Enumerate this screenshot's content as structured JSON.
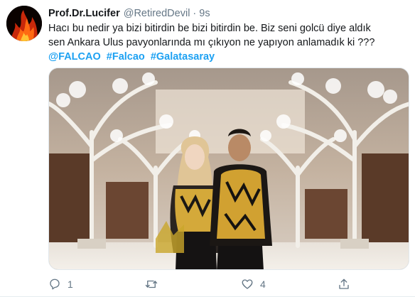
{
  "tweet": {
    "display_name": "Prof.Dr.Lucifer",
    "handle": "@RetiredDevil",
    "separator": "·",
    "time": "9s",
    "text_line1": "Hacı bu nedir ya bizi bitirdin be bizi bitirdin be. Biz seni golcü diye aldık",
    "text_line2": "sen Ankara Ulus pavyonlarında mı çıkıyon ne yapıyon anlamadık ki ???",
    "tags": [
      "@FALCAO",
      "#Falcao",
      "#Galatasaray"
    ]
  },
  "actions": {
    "reply": {
      "icon": "reply-icon",
      "count": "1"
    },
    "retweet": {
      "icon": "retweet-icon",
      "count": ""
    },
    "like": {
      "icon": "heart-icon",
      "count": "4"
    },
    "share": {
      "icon": "share-icon",
      "count": ""
    }
  },
  "colors": {
    "link": "#1da1f2",
    "muted": "#657786",
    "text": "#14171a"
  }
}
